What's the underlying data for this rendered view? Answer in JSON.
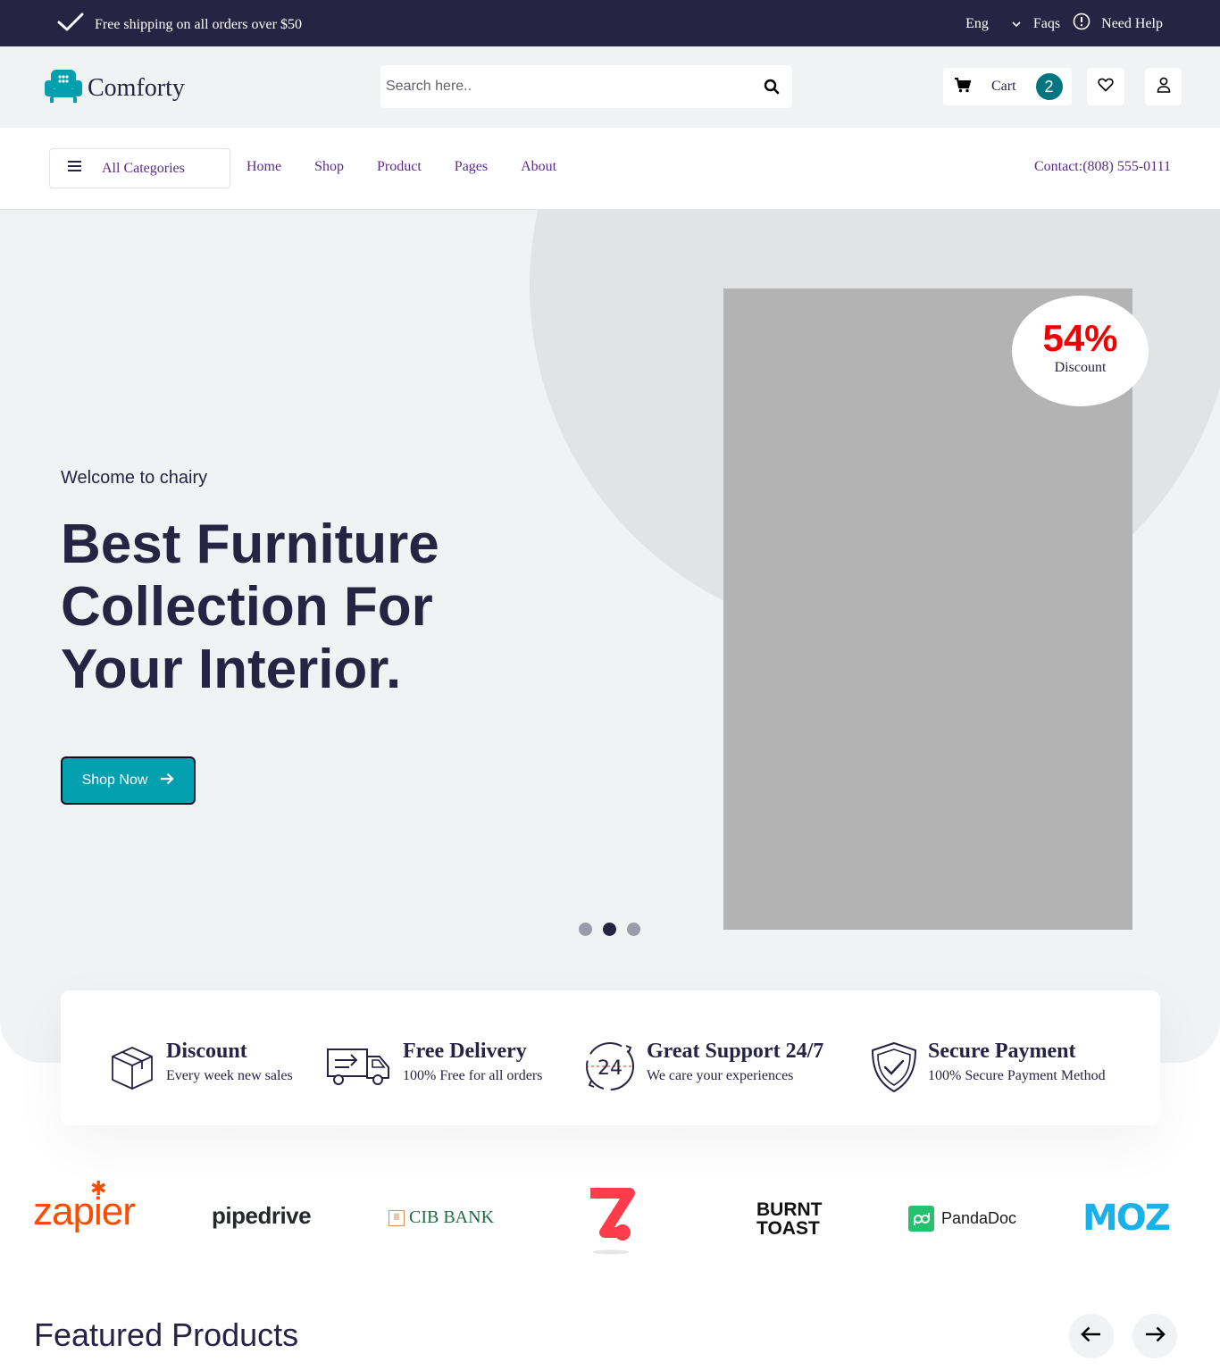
{
  "topbar": {
    "shipping_text": "Free shipping on all orders over $50",
    "language": "Eng",
    "faqs": "Faqs",
    "help": "Need Help"
  },
  "header": {
    "brand": "Comforty",
    "search_placeholder": "Search here..",
    "cart_label": "Cart",
    "cart_count": "2"
  },
  "nav": {
    "categories_label": "All Categories",
    "links": [
      "Home",
      "Shop",
      "Product",
      "Pages",
      "About"
    ],
    "contact": "Contact:(808) 555-0111"
  },
  "hero": {
    "welcome": "Welcome to chairy",
    "headline_lines": [
      "Best Furniture",
      "Collection For",
      "Your Interior."
    ],
    "cta": "Shop Now",
    "discount_percent": "54%",
    "discount_label": "Discount",
    "active_slide": 2,
    "slide_count": 3
  },
  "features": [
    {
      "icon": "box-icon",
      "title": "Discount",
      "subtitle": "Every week new sales"
    },
    {
      "icon": "truck-icon",
      "title": "Free Delivery",
      "subtitle": "100% Free for all orders"
    },
    {
      "icon": "support-24-icon",
      "title": "Great Support 24/7",
      "subtitle": "We care your experiences"
    },
    {
      "icon": "shield-check-icon",
      "title": "Secure Payment",
      "subtitle": "100% Secure Payment Method"
    }
  ],
  "brands": {
    "zapier": "zapier",
    "pipedrive": "pipedrive",
    "cib": "CIB BANK",
    "burnt_line1": "BURNT",
    "burnt_line2": "TOAST",
    "pandadoc": "PandaDoc",
    "moz": "MOZ"
  },
  "featured": {
    "title": "Featured Products"
  },
  "colors": {
    "brand_dark": "#272343",
    "accent_teal": "#029fae",
    "badge_teal": "#007580",
    "discount_red": "#f20000"
  }
}
